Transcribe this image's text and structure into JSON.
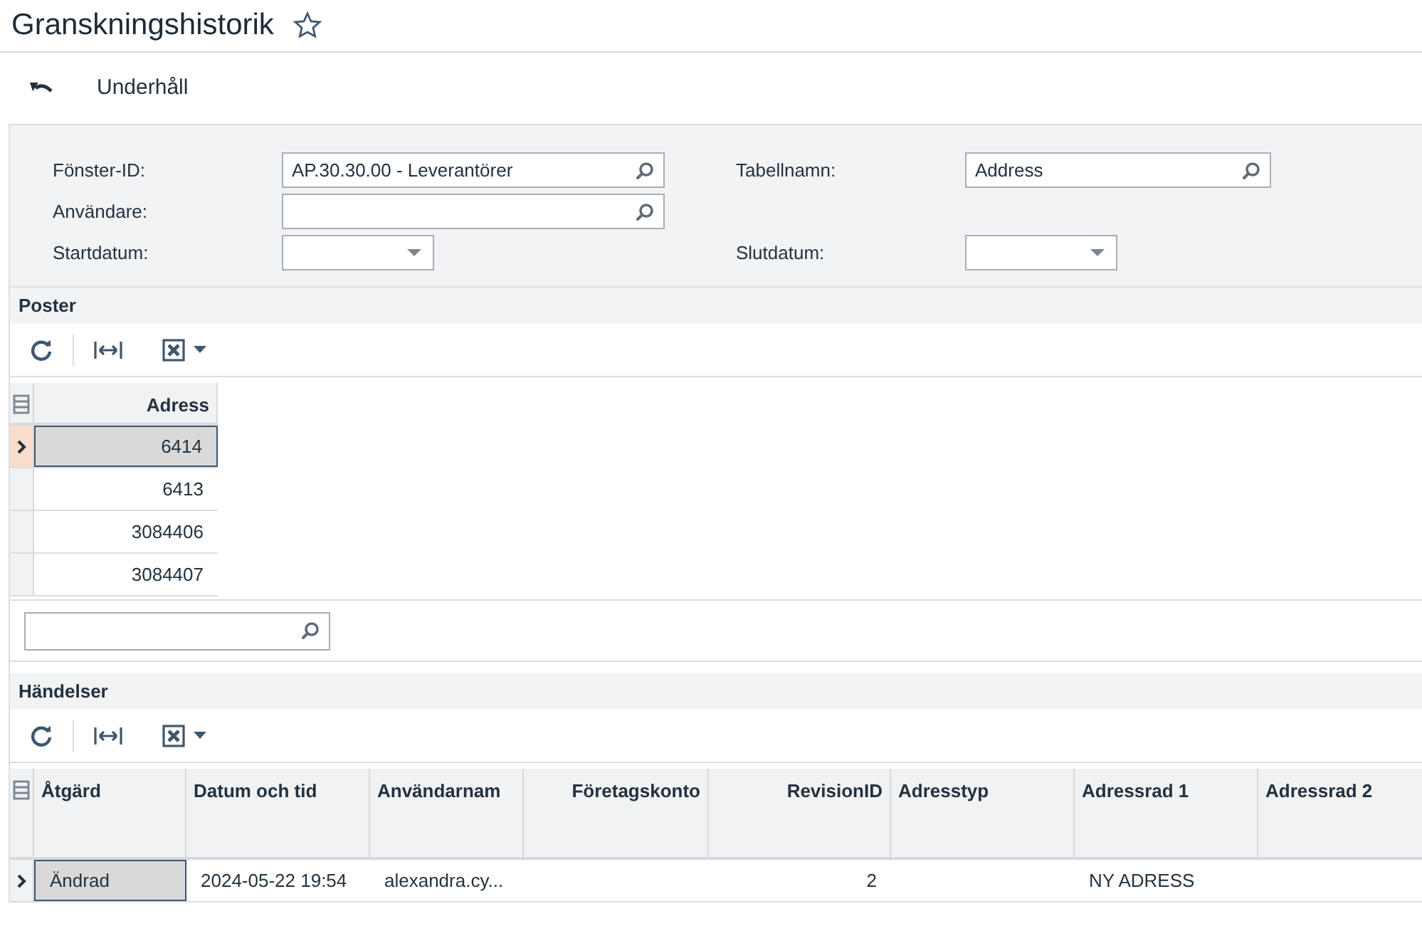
{
  "page": {
    "title": "Granskningshistorik",
    "favorite": false
  },
  "toolbar": {
    "label": "Underhåll"
  },
  "filters": [
    {
      "left": {
        "label": "Fönster-ID:",
        "kind": "lookup",
        "value": "AP.30.30.00 - Leverantörer"
      },
      "right": {
        "label": "Tabellnamn:",
        "kind": "lookup",
        "value": "Address"
      }
    },
    {
      "left": {
        "label": "Användare:",
        "kind": "lookup"
      }
    },
    {
      "left": {
        "label": "Startdatum:",
        "kind": "date"
      },
      "right": {
        "label": "Slutdatum:",
        "kind": "date"
      }
    }
  ],
  "poster": {
    "title": "Poster",
    "columns": [
      {
        "label": "Adress",
        "kind": "number"
      }
    ],
    "rows": [
      {
        "selected": true,
        "cells": [
          "6414"
        ]
      },
      {
        "selected": false,
        "cells": [
          "6413"
        ]
      },
      {
        "selected": false,
        "cells": [
          "3084406"
        ]
      },
      {
        "selected": false,
        "cells": [
          "3084407"
        ]
      }
    ]
  },
  "handelser": {
    "title": "Händelser",
    "columns": [
      {
        "label": "Åtgärd",
        "kind": "text"
      },
      {
        "label": "Datum och tid",
        "kind": "text"
      },
      {
        "label": "Användarnam",
        "kind": "text"
      },
      {
        "label": "Företagskonto",
        "kind": "number"
      },
      {
        "label": "RevisionID",
        "kind": "number"
      },
      {
        "label": "Adresstyp",
        "kind": "text"
      },
      {
        "label": "Adressrad 1",
        "kind": "text"
      },
      {
        "label": "Adressrad 2",
        "kind": "text"
      }
    ],
    "rows": [
      {
        "selected": true,
        "cells": [
          "Ändrad",
          "2024-05-22 19:54",
          "alexandra.cy...",
          null,
          "2",
          null,
          "NY ADRESS",
          null
        ]
      }
    ]
  }
}
